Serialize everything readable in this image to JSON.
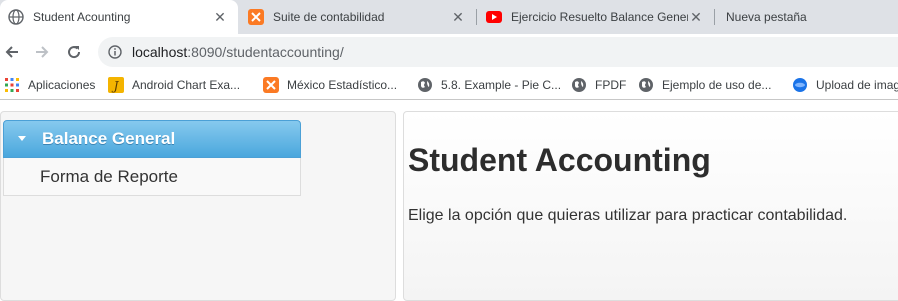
{
  "browser": {
    "tabs": [
      {
        "title": "Student Acounting",
        "favicon": "globe-icon",
        "active": true
      },
      {
        "title": "Suite de contabilidad",
        "favicon": "xampp-icon",
        "active": false
      },
      {
        "title": "Ejercicio Resuelto Balance Genera",
        "favicon": "youtube-icon",
        "active": false
      },
      {
        "title": "Nueva pestaña",
        "favicon": "none",
        "active": false
      }
    ],
    "url_host": "localhost",
    "url_rest": ":8090/studentaccounting/",
    "bookmarks": [
      {
        "label": "Aplicaciones",
        "icon": "apps-grid-icon"
      },
      {
        "label": "Android Chart Exa...",
        "icon": "j-icon"
      },
      {
        "label": "México Estadístico...",
        "icon": "xampp-icon"
      },
      {
        "label": "5.8. Example - Pie C...",
        "icon": "globe-icon"
      },
      {
        "label": "FPDF",
        "icon": "globe-icon"
      },
      {
        "label": "Ejemplo de uso de...",
        "icon": "globe-icon"
      },
      {
        "label": "Upload de imag",
        "icon": "blue-circle-icon"
      }
    ]
  },
  "sidebar": {
    "header": "Balance General",
    "items": [
      "Forma de Reporte"
    ]
  },
  "main": {
    "title": "Student Accounting",
    "description": "Elige la opción que quieras utilizar para practicar contabilidad."
  },
  "colors": {
    "accent": "#4aa7dd",
    "tabstrip": "#dee1e6",
    "youtube": "#ff0000",
    "xampp": "#fb7a24"
  }
}
